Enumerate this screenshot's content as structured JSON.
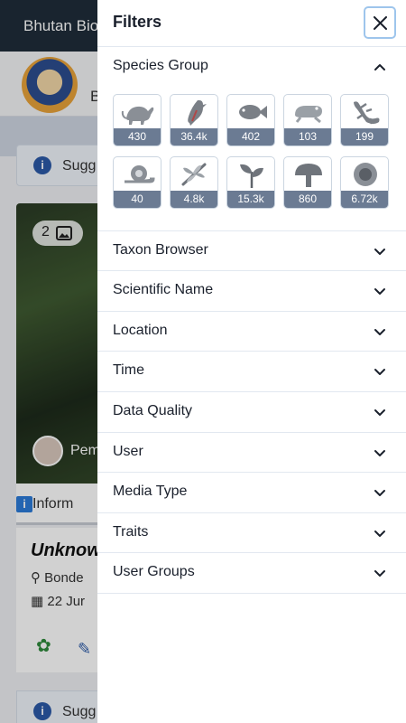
{
  "background": {
    "app_title": "Bhutan Bio",
    "logo_text": "B",
    "suggestion_label": "Sugg",
    "image_count": "2",
    "user_name": "Pem",
    "info_label": "Inform",
    "observation_name": "Unknow",
    "location_text": "Bonde",
    "date_text": "22 Jur",
    "suggestion_label_2": "Sugg"
  },
  "drawer": {
    "title": "Filters",
    "species_group": {
      "label": "Species Group",
      "tiles": [
        {
          "icon": "mammal-icon",
          "count": "430"
        },
        {
          "icon": "bird-icon",
          "count": "36.4k"
        },
        {
          "icon": "fish-icon",
          "count": "402"
        },
        {
          "icon": "amphibian-icon",
          "count": "103"
        },
        {
          "icon": "reptile-icon",
          "count": "199"
        },
        {
          "icon": "mollusc-icon",
          "count": "40"
        },
        {
          "icon": "insect-icon",
          "count": "4.8k"
        },
        {
          "icon": "plant-icon",
          "count": "15.3k"
        },
        {
          "icon": "fungi-icon",
          "count": "860"
        },
        {
          "icon": "other-icon",
          "count": "6.72k"
        }
      ]
    },
    "sections": [
      {
        "label": "Taxon Browser"
      },
      {
        "label": "Scientific Name"
      },
      {
        "label": "Location"
      },
      {
        "label": "Time"
      },
      {
        "label": "Data Quality"
      },
      {
        "label": "User"
      },
      {
        "label": "Media Type"
      },
      {
        "label": "Traits"
      },
      {
        "label": "User Groups"
      }
    ]
  },
  "colors": {
    "count_bar": "#6b7b93",
    "close_focus_ring": "#9ec5ec",
    "topbar": "#1f2d3a"
  }
}
